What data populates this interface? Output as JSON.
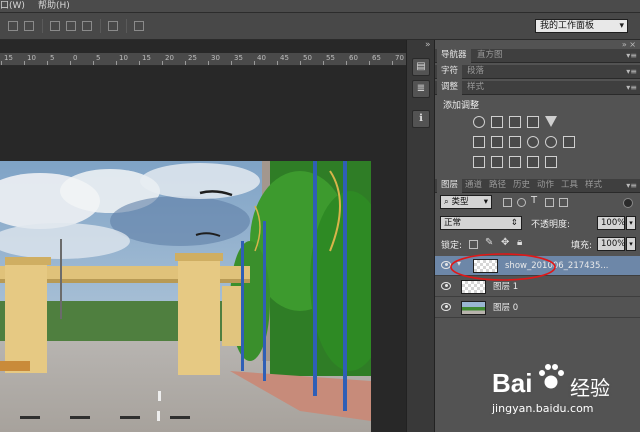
{
  "menubar": {
    "items": [
      "口(W)",
      "帮助(H)"
    ]
  },
  "options_bar": {
    "workspace": "我的工作面板"
  },
  "ruler": {
    "labels": [
      "15",
      "10",
      "5",
      "0",
      "5",
      "10",
      "15",
      "20",
      "25",
      "30",
      "35",
      "40",
      "45",
      "50",
      "55",
      "60",
      "65",
      "70"
    ]
  },
  "right_column": {
    "collapse": "»"
  },
  "panel_group_1": {
    "tabs": [
      "导航器",
      "直方图"
    ]
  },
  "panel_group_2": {
    "tabs": [
      "字符",
      "段落"
    ]
  },
  "panel_group_3": {
    "tabs": [
      "调整",
      "样式"
    ],
    "add_adjustment": "添加调整"
  },
  "layers_panel": {
    "tabs": [
      "图层",
      "通道",
      "路径",
      "历史",
      "动作",
      "工具",
      "样式"
    ],
    "filter_kind": "类型",
    "blend_mode": "正常",
    "opacity_label": "不透明度:",
    "opacity_value": "100%",
    "lock_label": "锁定:",
    "fill_label": "填充:",
    "fill_value": "100%",
    "layers": [
      {
        "name": "show_201006_217435...",
        "selected": true
      },
      {
        "name": "图层 1",
        "selected": false
      },
      {
        "name": "图层 0",
        "selected": false
      }
    ]
  },
  "watermark": {
    "brand": "Bai",
    "brand2": "经验",
    "url": "jingyan.baidu.com"
  },
  "colors": {
    "accent_selected": "#6d87a8",
    "annotation": "#e01818"
  }
}
